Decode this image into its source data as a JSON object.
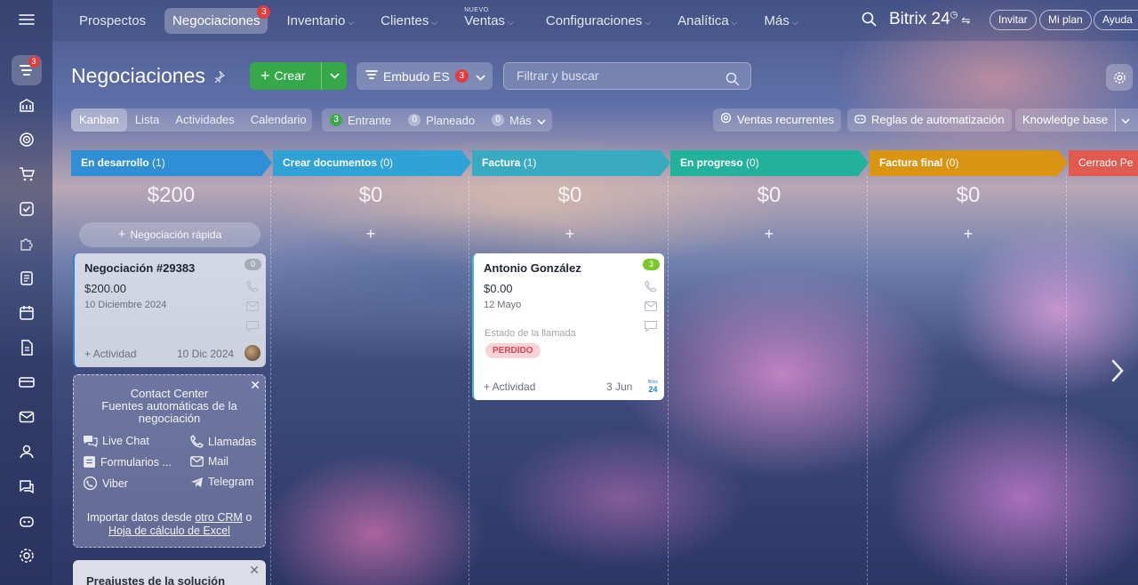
{
  "rail": {
    "badge": "3",
    "icons": [
      "crm-funnel-icon",
      "bank-icon",
      "target-icon",
      "cart-icon",
      "checkbox-icon",
      "puzzle-icon",
      "notes-icon",
      "calendar-icon",
      "document-icon",
      "card-icon",
      "mail-icon",
      "contacts-icon",
      "chat-icon",
      "robot-icon",
      "gear-icon"
    ]
  },
  "topnav": {
    "items": [
      {
        "label": "Prospectos",
        "chevron": false
      },
      {
        "label": "Negociaciones",
        "active": true,
        "badge": "3"
      },
      {
        "label": "Inventario",
        "chevron": true
      },
      {
        "label": "Clientes",
        "chevron": true
      },
      {
        "label": "Ventas",
        "chevron": true,
        "tag": "NUEVO"
      },
      {
        "label": "Configuraciones",
        "chevron": true
      },
      {
        "label": "Analítica",
        "chevron": true
      },
      {
        "label": "Más",
        "chevron": true
      }
    ],
    "brand": "Bitrix 24",
    "invite": "Invitar",
    "myplan": "Mi plan",
    "help": "Ayuda"
  },
  "header": {
    "title": "Negociaciones",
    "create_label": "Crear",
    "funnel_label": "Embudo ES",
    "funnel_badge": "3",
    "filter_placeholder": "Filtrar y buscar"
  },
  "views": [
    "Kanban",
    "Lista",
    "Actividades",
    "Calendario"
  ],
  "counters": [
    {
      "count": "3",
      "label": "Entrante"
    },
    {
      "count": "0",
      "label": "Planeado"
    },
    {
      "count": "0",
      "label": "Más"
    }
  ],
  "tools": {
    "recurring": "Ventas recurrentes",
    "automation": "Reglas de automatización",
    "kb": "Knowledge base"
  },
  "stages": [
    {
      "name": "En desarrollo",
      "count": "(1)",
      "sum": "$200",
      "color": "#2f8fd6"
    },
    {
      "name": "Crear documentos",
      "count": "(0)",
      "sum": "$0",
      "color": "#2fa3d6"
    },
    {
      "name": "Factura",
      "count": "(1)",
      "sum": "$0",
      "color": "#39abc0"
    },
    {
      "name": "En progreso",
      "count": "(0)",
      "sum": "$0",
      "color": "#22b19a"
    },
    {
      "name": "Factura final",
      "count": "(0)",
      "sum": "$0",
      "color": "#d99511"
    },
    {
      "name": "Cerrado Pe",
      "count": "",
      "sum": "",
      "color": "#e05a50"
    }
  ],
  "quick_deal": "Negociación rápida",
  "plus": "+",
  "cards": [
    {
      "title": "Negociación #29383",
      "badge": "0",
      "amount": "$200.00",
      "date": "10 Diciembre 2024",
      "activity": "+ Actividad",
      "footer_date": "10 Dic 2024"
    },
    {
      "title": "Antonio González",
      "badge": "3",
      "amount": "$0.00",
      "date": "12 Mayo",
      "call_label": "Estado de la llamada",
      "status": "PERDIDO",
      "activity": "+ Actividad",
      "footer_date": "3 Jun",
      "logo_top": "Bitrix",
      "logo_main": "24"
    }
  ],
  "contact_center": {
    "title_line1": "Contact Center",
    "title_line2": "Fuentes automáticas de la",
    "title_line3": "negociación",
    "channels": [
      "Live Chat",
      "Llamadas",
      "Formularios ...",
      "Mail",
      "Viber",
      "Telegram"
    ],
    "import_prefix": "Importar datos desde",
    "import_link1": "otro CRM",
    "import_mid": "o",
    "import_link2": "Hoja de cálculo de Excel"
  },
  "preset": {
    "title": "Preajustes de la solución"
  }
}
